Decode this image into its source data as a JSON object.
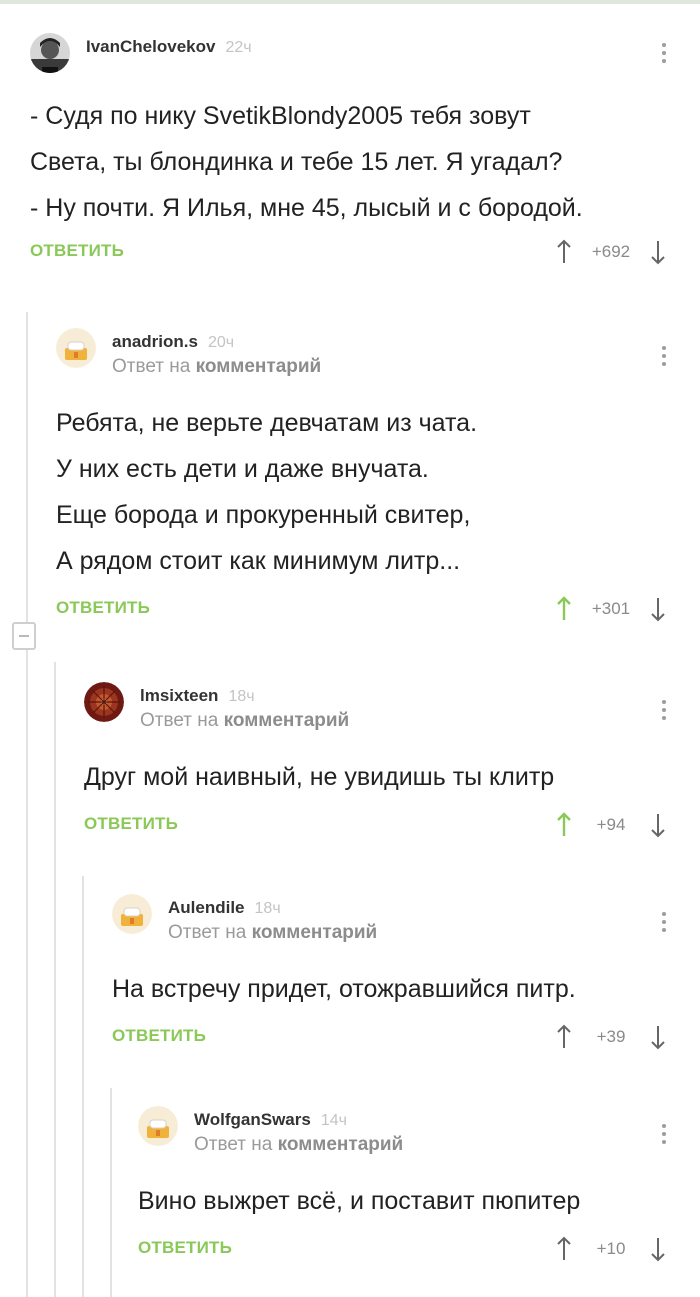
{
  "comments": [
    {
      "author": "IvanChelovekov",
      "time": "22ч",
      "text_lines": [
        "- Судя по нику SvetikBlondy2005 тебя зовут",
        "Света, ты блондинка и тебе 15 лет. Я угадал?",
        "- Ну почти. Я Илья, мне 45, лысый и с бородой."
      ],
      "reply_label": "ОТВЕТИТЬ",
      "score": "+692",
      "upvoted": false
    },
    {
      "author": "anadrion.s",
      "time": "20ч",
      "reply_prefix": "Ответ на",
      "reply_link": "комментарий",
      "text_lines": [
        "Ребята, не верьте девчатам из чата.",
        "У них есть дети и даже внучата.",
        "Еще борода и прокуренный свитер,",
        "А рядом стоит как минимум литр..."
      ],
      "reply_label": "ОТВЕТИТЬ",
      "score": "+301",
      "upvoted": true
    },
    {
      "author": "lmsixteen",
      "time": "18ч",
      "reply_prefix": "Ответ на",
      "reply_link": "комментарий",
      "text_lines": [
        "Друг мой наивный, не увидишь ты клитр"
      ],
      "reply_label": "ОТВЕТИТЬ",
      "score": "+94",
      "upvoted": true
    },
    {
      "author": "Aulendile",
      "time": "18ч",
      "reply_prefix": "Ответ на",
      "reply_link": "комментарий",
      "text_lines": [
        "На встречу придет, отожравшийся питр."
      ],
      "reply_label": "ОТВЕТИТЬ",
      "score": "+39",
      "upvoted": false
    },
    {
      "author": "WolfganSwars",
      "time": "14ч",
      "reply_prefix": "Ответ на",
      "reply_link": "комментарий",
      "text_lines": [
        "Вино выжрет всё, и поставит пюпитер"
      ],
      "reply_label": "ОТВЕТИТЬ",
      "score": "+10",
      "upvoted": false
    }
  ],
  "colors": {
    "accent_green": "#8ac858",
    "muted_text": "#9a9a9a",
    "thread_line": "#e2e2e2"
  },
  "icons": {
    "menu": "kebab-menu-icon",
    "upvote": "arrow-up-icon",
    "downvote": "arrow-down-icon",
    "collapse": "collapse-thread-icon"
  }
}
